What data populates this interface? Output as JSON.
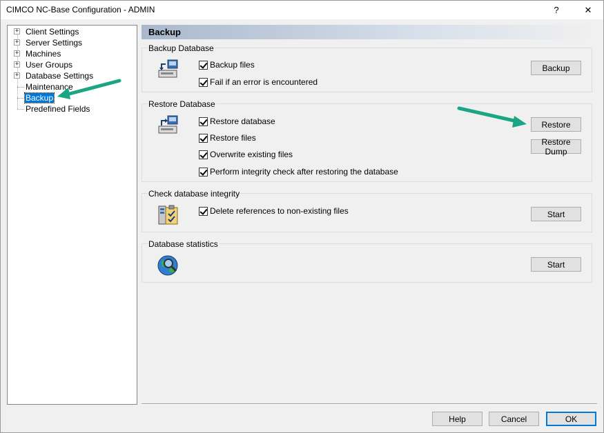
{
  "window": {
    "title": "CIMCO NC-Base Configuration - ADMIN",
    "help_glyph": "?",
    "close_glyph": "✕"
  },
  "tree": {
    "items": [
      {
        "label": "Client Settings",
        "expandable": true
      },
      {
        "label": "Server Settings",
        "expandable": true
      },
      {
        "label": "Machines",
        "expandable": true
      },
      {
        "label": "User Groups",
        "expandable": true
      },
      {
        "label": "Database Settings",
        "expandable": true
      },
      {
        "label": "Maintenance",
        "expandable": false
      },
      {
        "label": "Backup",
        "expandable": false,
        "selected": true
      },
      {
        "label": "Predefined Fields",
        "expandable": false
      }
    ],
    "expander_glyph": "+"
  },
  "page": {
    "title": "Backup"
  },
  "backup_db": {
    "title": "Backup Database",
    "checks": [
      {
        "label": "Backup files",
        "checked": true
      },
      {
        "label": "Fail if an error is encountered",
        "checked": true
      }
    ],
    "button": "Backup"
  },
  "restore_db": {
    "title": "Restore Database",
    "checks": [
      {
        "label": "Restore database",
        "checked": true
      },
      {
        "label": "Restore files",
        "checked": true
      },
      {
        "label": "Overwrite existing files",
        "checked": true
      },
      {
        "label": "Perform integrity check after restoring the database",
        "checked": true
      }
    ],
    "restore_button": "Restore",
    "restore_dump_button": "Restore Dump"
  },
  "integrity": {
    "title": "Check database integrity",
    "checks": [
      {
        "label": "Delete references to non-existing files",
        "checked": true
      }
    ],
    "button": "Start"
  },
  "stats": {
    "title": "Database statistics",
    "button": "Start"
  },
  "footer": {
    "help": "Help",
    "cancel": "Cancel",
    "ok": "OK"
  },
  "colors": {
    "arrow": "#1aa585",
    "selection": "#0078d7",
    "accent": "#0078d7"
  }
}
